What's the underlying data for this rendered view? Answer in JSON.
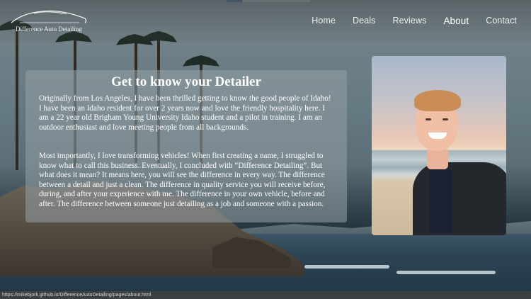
{
  "brand": {
    "name": "Difference Auto Detailing",
    "logo_icon": "car-outline-icon"
  },
  "nav": {
    "items": [
      {
        "label": "Home"
      },
      {
        "label": "Deals"
      },
      {
        "label": "Reviews"
      },
      {
        "label": "About",
        "active": true
      },
      {
        "label": "Contact"
      }
    ]
  },
  "about": {
    "title": "Get to know your Detailer",
    "paragraphs": [
      "Originally from Los Angeles, I have been thrilled getting to know the good people of Idaho! I have been an Idaho resident for over 2 years now and love the friendly hospitality here. I am a 22 year old Brigham Young University Idaho student and a pilot in training. I am an outdoor enthusiast and love meeting people from all backgrounds.",
      "Most importantly, I love transforming vehicles! When first creating a name, I struggled to know what to call this business. Eventually, I concluded with “Difference Detailing”. But what does it mean? It means here, you will see the difference in every way. The difference between a detail and just a clean. The difference in quality service you will receive before, during, and after your experience with me. The difference in your own vehicle, before and after. The difference between someone just detailing as a job and someone with a passion."
    ]
  },
  "status": {
    "url": "https://mikebjork.github.io/DifferenceAutoDetailing/pages/about.html"
  },
  "colors": {
    "panel_bg": "#96a0a6",
    "text": "#ffffff",
    "statusbar": "#3c3f41"
  }
}
